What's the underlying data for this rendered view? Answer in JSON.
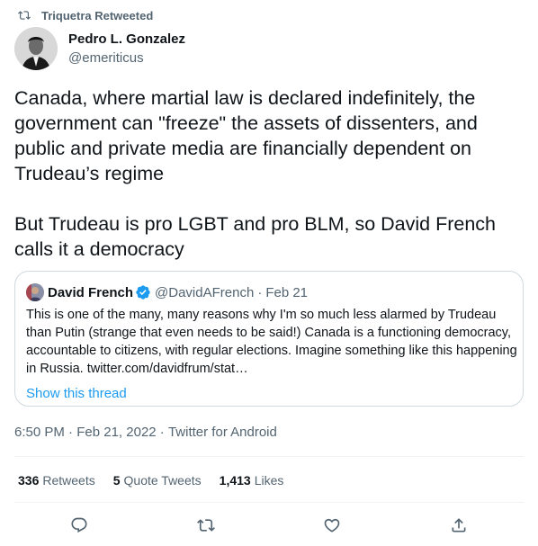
{
  "retweet_context": {
    "text": "Triquetra Retweeted",
    "icon": "retweet-icon"
  },
  "author": {
    "name": "Pedro L. Gonzalez",
    "handle": "@emeriticus"
  },
  "tweet": {
    "text": "Canada, where martial law is declared indefinitely, the government can \"freeze\" the assets of dissenters, and public and private media are financially dependent on Trudeau’s regime\n\nBut Trudeau is pro LGBT and pro BLM, so David French calls it a democracy"
  },
  "quote": {
    "name": "David French",
    "handle": "@DavidAFrench",
    "separator": "·",
    "date": "Feb 21",
    "text": "This is one of the many, many reasons why I'm so much less alarmed by Trudeau than Putin (strange that even needs to be said!) Canada is a functioning democracy, accountable to citizens, with regular elections. Imagine something like this happening in Russia. twitter.com/davidfrum/stat…",
    "show_thread": "Show this thread"
  },
  "meta": {
    "time": "6:50 PM",
    "date": "Feb 21, 2022",
    "source": "Twitter for Android",
    "separator": " · "
  },
  "stats": [
    {
      "count": "336",
      "label": "Retweets"
    },
    {
      "count": "5",
      "label": "Quote Tweets"
    },
    {
      "count": "1,413",
      "label": "Likes"
    }
  ],
  "actions": [
    "reply-icon",
    "retweet-icon",
    "like-icon",
    "share-icon"
  ],
  "colors": {
    "text": "#0f1419",
    "secondary": "#536471",
    "link": "#1d9bf0",
    "border": "#cfd9de",
    "verified": "#1d9bf0"
  }
}
